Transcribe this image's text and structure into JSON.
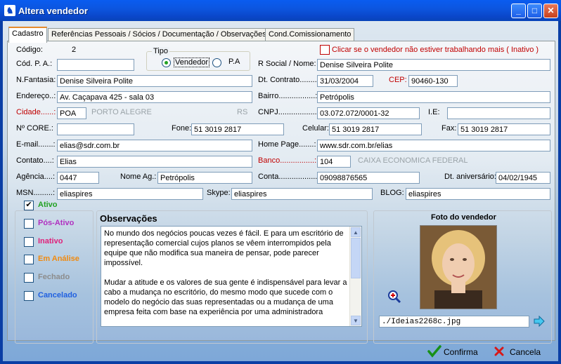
{
  "window": {
    "title": "Altera vendedor"
  },
  "tabs": [
    "Cadastro",
    "Referências Pessoais / Sócios / Documentação / Observações",
    "Cond.Comissionamento"
  ],
  "form": {
    "codigo_label": "Código:",
    "codigo_value": "2",
    "tipo_label": "Tipo",
    "tipo_vendedor": "Vendedor",
    "tipo_pa": "P.A",
    "inativo_check_label": "Clicar se o vendedor não estiver trabalhando mais ( Inativo )",
    "cod_pa_label": "Cód. P. A.:",
    "cod_pa_value": "",
    "rsocial_label": "R Social / Nome:",
    "rsocial_value": "Denise Silveira Polite",
    "nfantasia_label": "N.Fantasia:",
    "nfantasia_value": "Denise Silveira Polite",
    "dt_contrato_label": "Dt. Contrato........:",
    "dt_contrato_value": "31/03/2004",
    "cep_label": "CEP:",
    "cep_value": "90460-130",
    "endereco_label": "Endereço..:",
    "endereco_value": "Av. Caçapava 425 - sala 03",
    "bairro_label": "Bairro.................:",
    "bairro_value": "Petrópolis",
    "cidade_label": "Cidade......:",
    "cidade_code": "POA",
    "cidade_name": "PORTO ALEGRE",
    "cidade_uf": "RS",
    "cnpj_label": "CNPJ..................:",
    "cnpj_value": "03.072.072/0001-32",
    "ie_label": "I.E:",
    "ie_value": "",
    "core_label": "Nº CORE.:",
    "core_value": "",
    "fone_label": "Fone:",
    "fone_value": "51 3019 2817",
    "celular_label": "Celular:",
    "celular_value": "51 3019 2817",
    "fax_label": "Fax:",
    "fax_value": "51 3019 2817",
    "email_label": "E-mail.......:",
    "email_value": "elias@sdr.com.br",
    "homepage_label": "Home Page.......:",
    "homepage_value": "www.sdr.com.br/elias",
    "contato_label": "Contato....:",
    "contato_value": "Elias",
    "banco_label": "Banco................:",
    "banco_value": "104",
    "banco_name": "CAIXA ECONOMICA FEDERAL",
    "agencia_label": "Agência....:",
    "agencia_value": "0447",
    "nome_ag_label": "Nome Ag.:",
    "nome_ag_value": "Petrópolis",
    "conta_label": "Conta..................:",
    "conta_value": "09098876565",
    "dt_aniversario_label": "Dt. aniversário:",
    "dt_aniversario_value": "04/02/1945",
    "msn_label": "MSN.........:",
    "msn_value": "eliaspires",
    "skype_label": "Skype:",
    "skype_value": "eliaspires",
    "blog_label": "BLOG:",
    "blog_value": "eliaspires"
  },
  "status": [
    {
      "label": "Ativo",
      "checked": true,
      "color": "#21a121"
    },
    {
      "label": "Pós-Ativo",
      "checked": false,
      "color": "#b030c0"
    },
    {
      "label": "Inativo",
      "checked": false,
      "color": "#e0207a"
    },
    {
      "label": "Em Análise",
      "checked": false,
      "color": "#f08a10"
    },
    {
      "label": "Fechado",
      "checked": false,
      "color": "#8c8c8c"
    },
    {
      "label": "Cancelado",
      "checked": false,
      "color": "#2060e0"
    }
  ],
  "observacoes": {
    "title": "Observações",
    "p1": "No mundo dos negócios poucas vezes é fácil. E para um escritório de representação comercial cujos planos se vêem interrompidos pela equipe que não modifica sua maneira de pensar, pode parecer impossível.",
    "p2": "Mudar a atitude e os valores de sua gente é indispensável para levar a cabo a mudança no escritório, do mesmo modo que sucede com o modelo do negócio das suas representadas ou a mudança de uma empresa feita com base na experiência por uma administradora"
  },
  "foto": {
    "title": "Foto do vendedor",
    "path": "./Ideias2268c.jpg"
  },
  "actions": {
    "confirma": "Confirma",
    "cancela": "Cancela"
  },
  "colors": {
    "title_bar": "#0a46c8",
    "required_label": "#c00000",
    "selected_tab_accent": "#e68b2c"
  }
}
